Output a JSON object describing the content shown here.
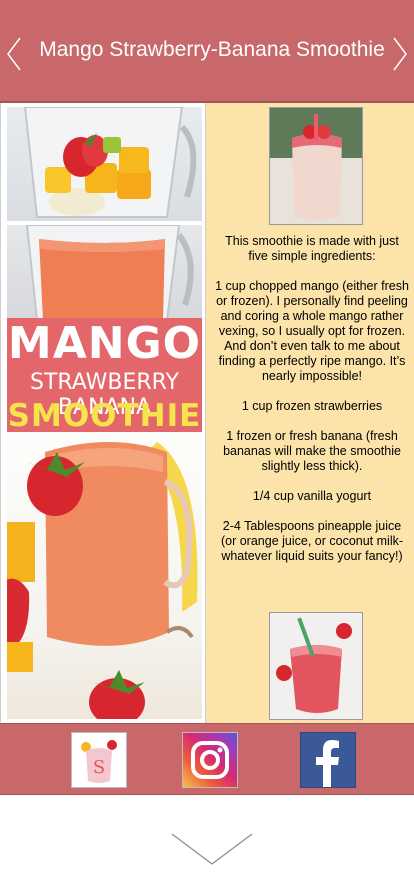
{
  "header": {
    "title": "Mango Strawberry-Banana Smoothie",
    "prev_icon": "chevron-left-icon",
    "next_icon": "chevron-right-icon"
  },
  "collage": {
    "word1": "MANGO",
    "word2": "STRAWBERRY BANANA",
    "word3": "SMOOTHIE"
  },
  "recipe": {
    "paragraphs": [
      "This smoothie is made with just five simple ingredients:",
      "1 cup chopped mango (either fresh or frozen). I personally find peeling and coring a whole mango rather vexing, so I usually opt for frozen. And don’t even talk to me about finding a perfectly ripe mango. It’s nearly impossible!",
      "1 cup frozen strawberries",
      "1 frozen or fresh banana (fresh bananas will make the smoothie slightly less thick).",
      "1/4 cup vanilla yogurt",
      "2-4 Tablespoons pineapple juice (or orange juice, or coconut milk- whatever liquid suits your fancy!)"
    ]
  },
  "social": {
    "items": [
      "app-icon",
      "instagram-icon",
      "facebook-icon"
    ]
  },
  "footer": {
    "icon": "chevron-down-icon"
  },
  "colors": {
    "header_bg": "#c8686b",
    "recipe_bg": "#fbe3a9",
    "banner_bg": "#e3676a",
    "banner_accent": "#f7e34b"
  }
}
